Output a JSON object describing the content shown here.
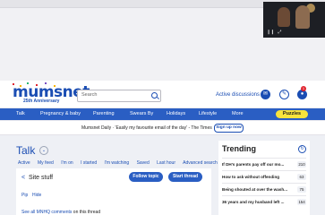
{
  "video": {
    "controls": [
      "❙❙",
      "⤢"
    ]
  },
  "header": {
    "logo": "mumsnet",
    "logo_sub": "25th Anniversary",
    "search_placeholder": "Search",
    "active_discussions": "Active discussions",
    "notification_count": "1"
  },
  "nav": {
    "items": [
      "Talk",
      "Pregnancy & baby",
      "Parenting",
      "Swears By",
      "Holidays",
      "Lifestyle",
      "More"
    ],
    "puzzles": "Puzzles"
  },
  "daily": {
    "text": "Mumsnet Daily · 'Easily my favourite email of the day' - The Times",
    "signup": "Sign up now"
  },
  "talk": {
    "title": "Talk",
    "subtabs": [
      "Active",
      "My feed",
      "I'm on",
      "I started",
      "I'm watching",
      "Saved",
      "Last hour",
      "Advanced search"
    ]
  },
  "topic": {
    "back": "<",
    "title": "Site stuff",
    "follow": "Follow topic",
    "start": "Start thread",
    "pip": "Pip",
    "hide": "Hide",
    "mnhq_link": "See all MNHQ comments",
    "mnhq_rest": " on this thread"
  },
  "trending": {
    "title": "Trending",
    "items": [
      {
        "title": "If DH's parents pay off our mo...",
        "count": "210"
      },
      {
        "title": "How to ask without offending",
        "count": "63"
      },
      {
        "title": "Being shouted at over the wash...",
        "count": "75"
      },
      {
        "title": "36 years and my husband left ...",
        "count": "154"
      }
    ]
  }
}
